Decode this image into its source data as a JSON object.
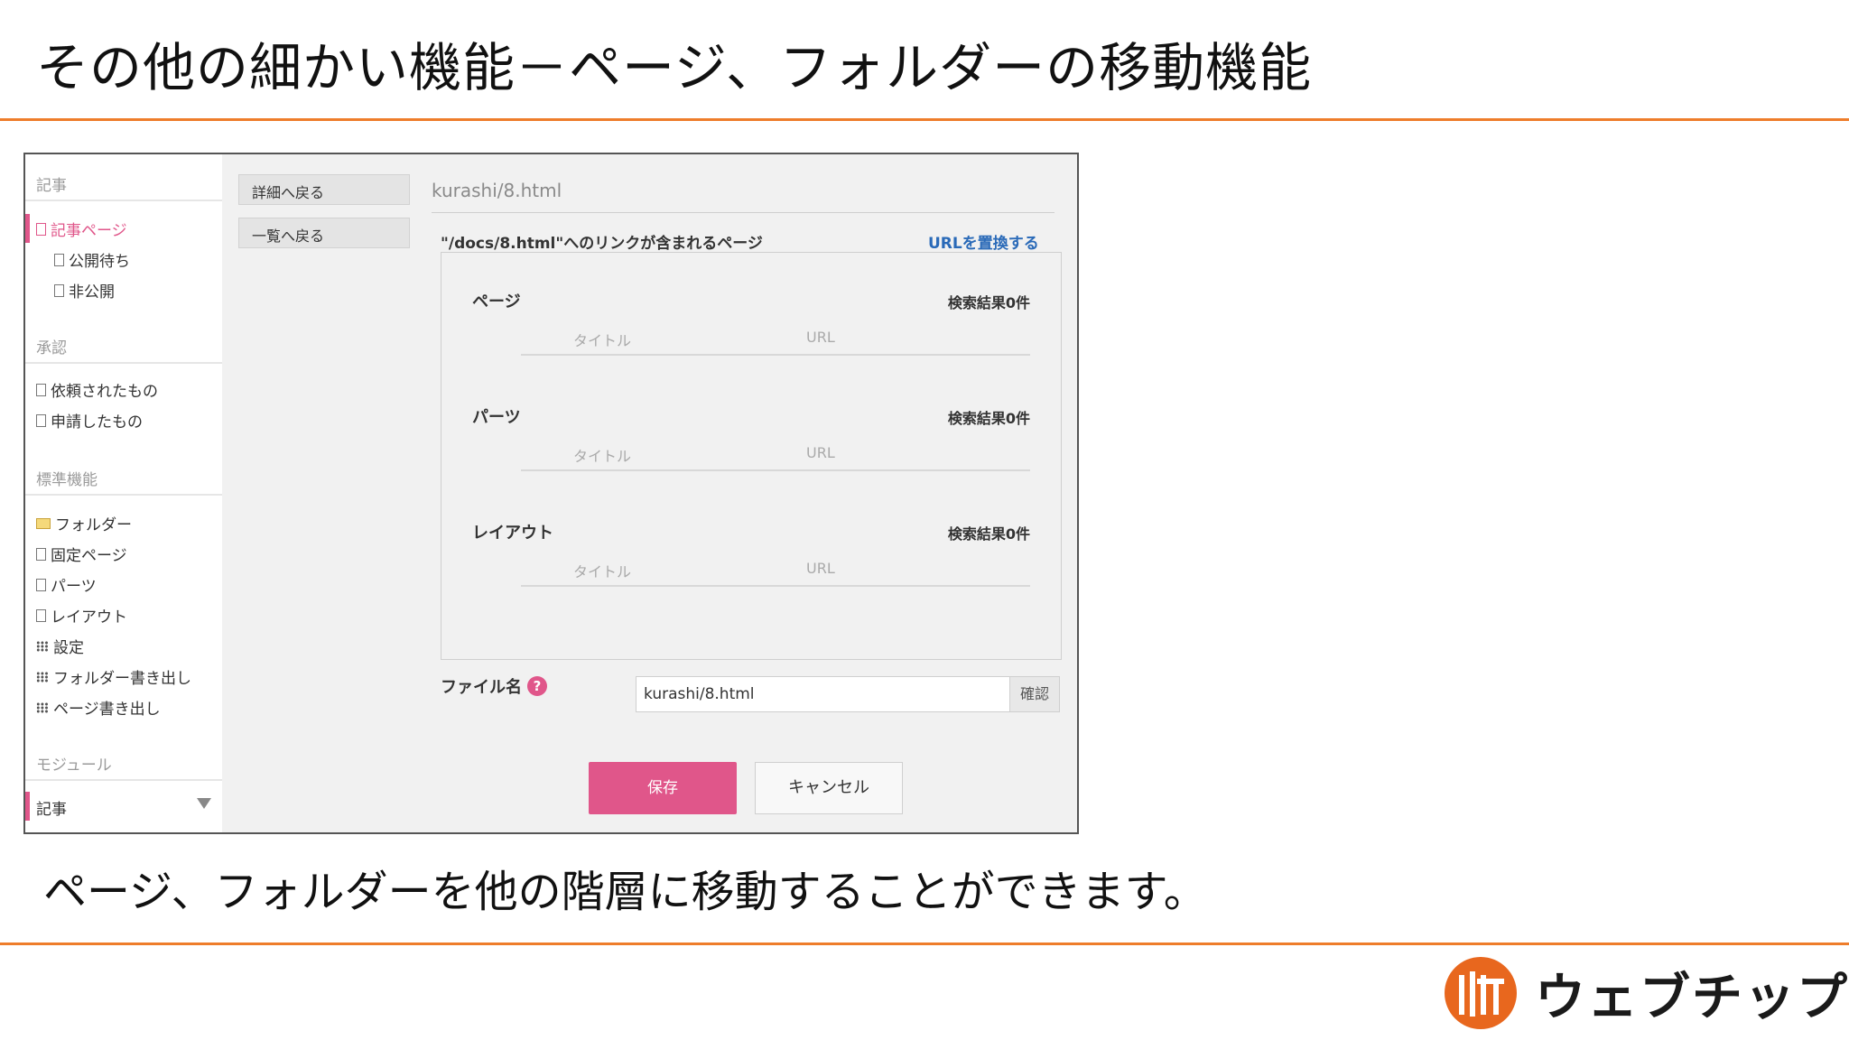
{
  "slide": {
    "title": "その他の細かい機能－ページ、フォルダーの移動機能",
    "caption": "ページ、フォルダーを他の階層に移動することができます。"
  },
  "sidebar": {
    "sections": [
      {
        "title": "記事",
        "items": [
          {
            "label": "記事ページ",
            "icon": "page-icon",
            "active": true
          },
          {
            "label": "公開待ち",
            "icon": "page-icon",
            "sub": true
          },
          {
            "label": "非公開",
            "icon": "page-icon",
            "sub": true
          }
        ]
      },
      {
        "title": "承認",
        "items": [
          {
            "label": "依頼されたもの",
            "icon": "page-icon"
          },
          {
            "label": "申請したもの",
            "icon": "page-icon"
          }
        ]
      },
      {
        "title": "標準機能",
        "items": [
          {
            "label": "フォルダー",
            "icon": "folder-icon"
          },
          {
            "label": "固定ページ",
            "icon": "page-icon"
          },
          {
            "label": "パーツ",
            "icon": "page-icon"
          },
          {
            "label": "レイアウト",
            "icon": "page-icon"
          },
          {
            "label": "設定",
            "icon": "grid-icon"
          },
          {
            "label": "フォルダー書き出し",
            "icon": "grid-icon"
          },
          {
            "label": "ページ書き出し",
            "icon": "grid-icon"
          }
        ]
      },
      {
        "title": "モジュール"
      }
    ],
    "module_selected": "記事"
  },
  "side_buttons": {
    "back_detail": "詳細へ戻る",
    "back_list": "一覧へ戻る"
  },
  "main": {
    "path": "kurashi/8.html",
    "link_heading": "\"/docs/8.html\"へのリンクが含まれるページ",
    "replace_link": "URLを置換する",
    "groups": [
      {
        "title": "ページ",
        "count": "検索結果0件",
        "col_title": "タイトル",
        "col_url": "URL"
      },
      {
        "title": "パーツ",
        "count": "検索結果0件",
        "col_title": "タイトル",
        "col_url": "URL"
      },
      {
        "title": "レイアウト",
        "count": "検索結果0件",
        "col_title": "タイトル",
        "col_url": "URL"
      }
    ],
    "filename_label": "ファイル名",
    "help_glyph": "?",
    "filename_value": "kurashi/8.html",
    "confirm": "確認",
    "save": "保存",
    "cancel": "キャンセル"
  },
  "logo": {
    "text": "ウェブチップス",
    "accent": "#e8671e"
  },
  "colors": {
    "rule": "#ee7d2b",
    "pink": "#e0568a",
    "link": "#2a6ab8"
  }
}
